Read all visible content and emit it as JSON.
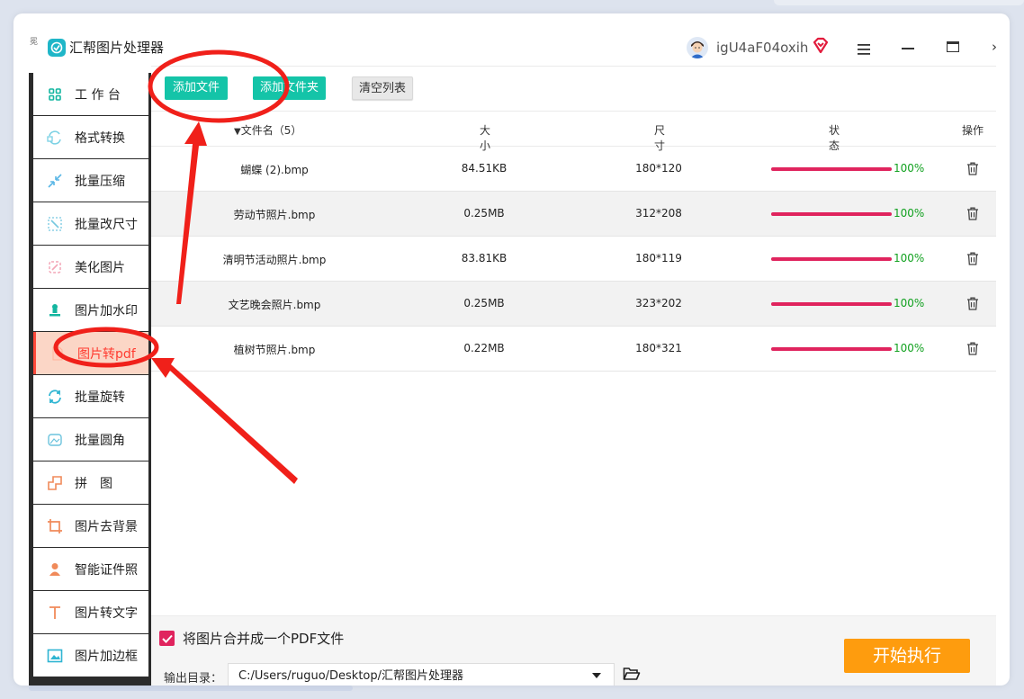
{
  "app": {
    "side_glyph": "冕",
    "title": "汇帮图片处理器",
    "username": "igU4aF04oxih"
  },
  "icons": {
    "logo": "app-logo-icon",
    "avatar": "user-avatar",
    "vip": "vip-diamond-icon",
    "menu": "menu-icon",
    "minimize": "minimize-icon",
    "maximize": "maximize-icon"
  },
  "sidebar": {
    "items": [
      {
        "label": "工 作 台",
        "icon": "grid-icon"
      },
      {
        "label": "格式转换",
        "icon": "convert-icon"
      },
      {
        "label": "批量压缩",
        "icon": "compress-icon"
      },
      {
        "label": "批量改尺寸",
        "icon": "resize-icon"
      },
      {
        "label": "美化图片",
        "icon": "beautify-icon"
      },
      {
        "label": "图片加水印",
        "icon": "watermark-icon"
      },
      {
        "label": "图片转pdf",
        "icon": "pdf-icon",
        "active": true
      },
      {
        "label": "批量旋转",
        "icon": "rotate-icon"
      },
      {
        "label": "批量圆角",
        "icon": "round-corner-icon"
      },
      {
        "label": "拼　图",
        "icon": "puzzle-icon"
      },
      {
        "label": "图片去背景",
        "icon": "crop-icon"
      },
      {
        "label": "智能证件照",
        "icon": "id-photo-icon"
      },
      {
        "label": "图片转文字",
        "icon": "text-icon"
      },
      {
        "label": "图片加边框",
        "icon": "frame-icon"
      }
    ]
  },
  "toolbar": {
    "add_file": "添加文件",
    "add_folder": "添加文件夹",
    "clear_list": "清空列表"
  },
  "table": {
    "headers": {
      "name": "文件名（5）",
      "size": "大小",
      "dimensions": "尺寸",
      "status": "状态",
      "action": "操作"
    },
    "rows": [
      {
        "name": "蝴蝶 (2).bmp",
        "size": "84.51KB",
        "dimensions": "180*120",
        "progress": 100,
        "progress_text": "100%"
      },
      {
        "name": "劳动节照片.bmp",
        "size": "0.25MB",
        "dimensions": "312*208",
        "progress": 100,
        "progress_text": "100%"
      },
      {
        "name": "清明节活动照片.bmp",
        "size": "83.81KB",
        "dimensions": "180*119",
        "progress": 100,
        "progress_text": "100%"
      },
      {
        "name": "文艺晚会照片.bmp",
        "size": "0.25MB",
        "dimensions": "323*202",
        "progress": 100,
        "progress_text": "100%"
      },
      {
        "name": "植树节照片.bmp",
        "size": "0.22MB",
        "dimensions": "180*321",
        "progress": 100,
        "progress_text": "100%"
      }
    ]
  },
  "bottom": {
    "merge_checked": true,
    "merge_label": "将图片合并成一个PDF文件",
    "output_label": "输出目录：",
    "output_path": "C:/Users/ruguo/Desktop/汇帮图片处理器",
    "start_button": "开始执行"
  },
  "colors": {
    "accent_teal": "#14c4a8",
    "active_red": "#ff3b30",
    "active_bg": "#fbd6c6",
    "progress": "#e0245e",
    "percent_green": "#11a11f",
    "start_orange": "#fe9c0e",
    "annotation_red": "#f0201a"
  }
}
